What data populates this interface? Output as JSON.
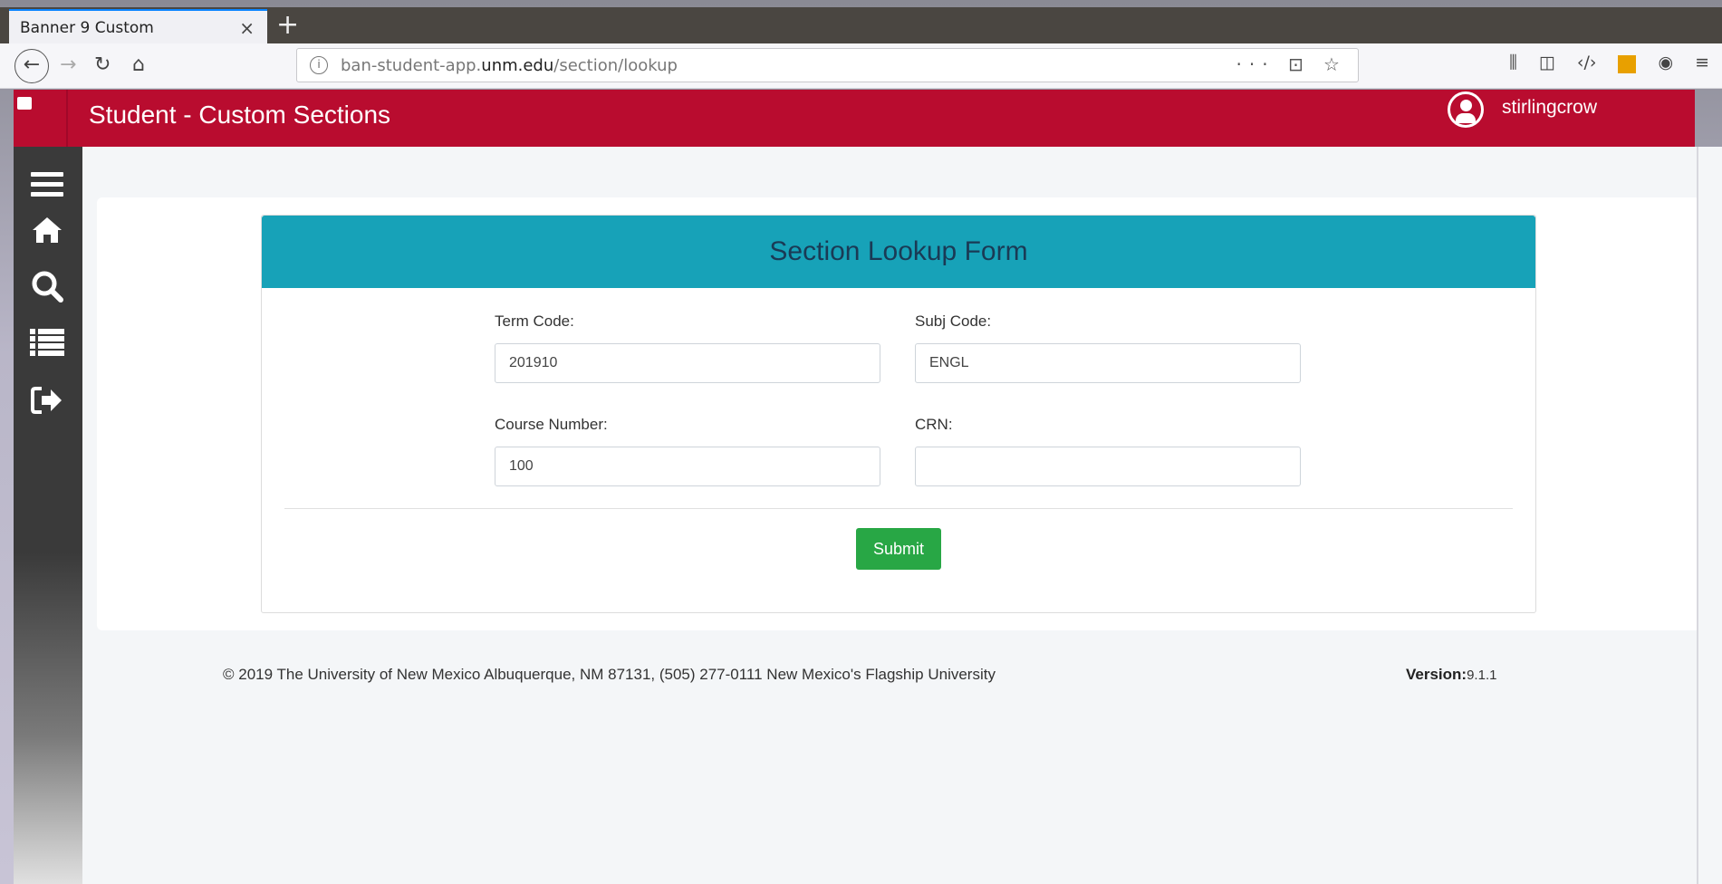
{
  "browser": {
    "tab_title": "Banner 9 Custom",
    "tab_close": "×",
    "new_tab": "+",
    "url_prefix": "ban-student-app.",
    "url_domain": "unm.edu",
    "url_path": "/section/lookup",
    "url_actions": "··· ⊡ ☆"
  },
  "app": {
    "title": "Student - Custom Sections",
    "username": "stirlingcrow",
    "accent": "#b90c2f"
  },
  "sidebar": {
    "items": [
      {
        "icon": "menu-icon"
      },
      {
        "icon": "home-icon"
      },
      {
        "icon": "search-icon"
      },
      {
        "icon": "list-icon"
      },
      {
        "icon": "sign-out-icon"
      }
    ]
  },
  "form": {
    "heading": "Section Lookup Form",
    "term_code_label": "Term Code:",
    "term_code_value": "201910",
    "subj_code_label": "Subj Code:",
    "subj_code_value": "ENGL",
    "course_number_label": "Course Number:",
    "course_number_value": "100",
    "crn_label": "CRN:",
    "crn_value": "",
    "submit_label": "Submit",
    "header_color": "#17a2b8",
    "submit_color": "#28a745"
  },
  "footer": {
    "copyright": "© 2019 The University of New Mexico Albuquerque, NM 87131, (505) 277-0111 New Mexico's Flagship University",
    "version_label": "Version:",
    "version_value": "9.1.1"
  }
}
